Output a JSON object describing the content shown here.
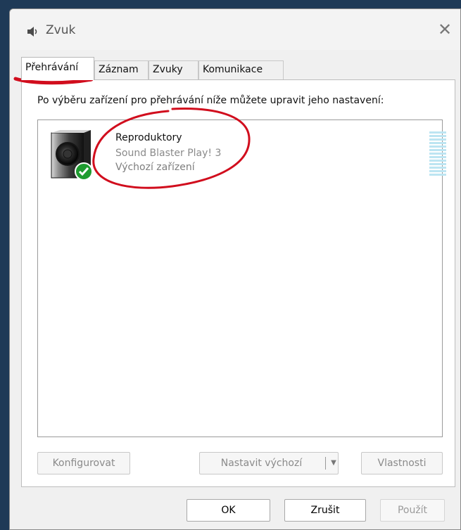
{
  "window": {
    "title": "Zvuk",
    "close_glyph": "✕"
  },
  "tabs": [
    {
      "label": "Přehrávání",
      "active": true
    },
    {
      "label": "Záznam"
    },
    {
      "label": "Zvuky"
    },
    {
      "label": "Komunikace"
    }
  ],
  "instruction": "Po výběru zařízení pro přehrávání níže můžete upravit jeho nastavení:",
  "device": {
    "name": "Reproduktory",
    "subtitle": "Sound Blaster Play! 3",
    "status": "Výchozí zařízení"
  },
  "buttons": {
    "configure": "Konfigurovat",
    "set_default": "Nastavit výchozí",
    "set_default_arrow": "▼",
    "properties": "Vlastnosti",
    "ok": "OK",
    "cancel": "Zrušit",
    "apply": "Použít"
  },
  "icons": {
    "app": "speaker-icon",
    "device": "speaker-device-icon",
    "status": "green-check-icon"
  },
  "colors": {
    "accent_annotation": "#d10d1d",
    "status_green": "#1e9b2f",
    "level_meter": "#bde5f2"
  }
}
